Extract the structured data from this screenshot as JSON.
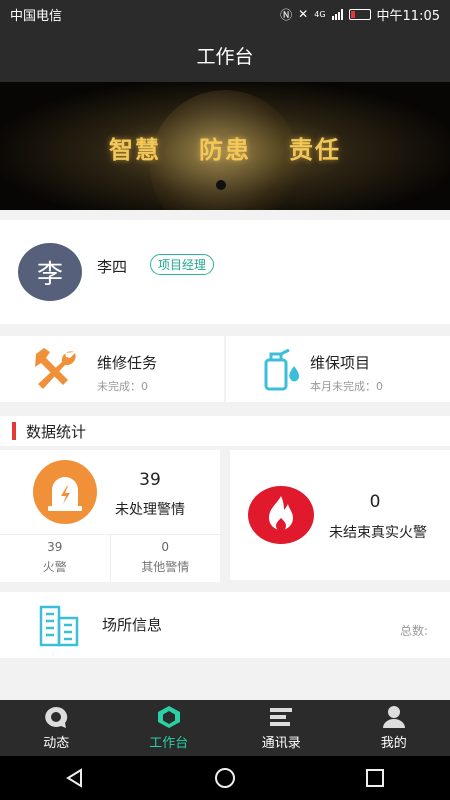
{
  "status": {
    "carrier": "中国电信",
    "time": "中午11:05",
    "network": "4G"
  },
  "header": {
    "title": "工作台"
  },
  "banner": {
    "slogans": [
      "智慧",
      "防患",
      "责任"
    ]
  },
  "user": {
    "avatar_char": "李",
    "name": "李四",
    "role": "项目经理"
  },
  "tasks": [
    {
      "title": "维修任务",
      "subtitle": "未完成：0",
      "icon": "tools-icon"
    },
    {
      "title": "维保项目",
      "subtitle": "本月未完成：0",
      "icon": "extinguisher-icon"
    }
  ],
  "stats_section": {
    "title": "数据统计"
  },
  "unhandled": {
    "count": "39",
    "label": "未处理警情"
  },
  "subcounts": [
    {
      "count": "39",
      "label": "火警"
    },
    {
      "count": "0",
      "label": "其他警情"
    }
  ],
  "fire": {
    "count": "0",
    "label": "未结束真实火警"
  },
  "place": {
    "title": "场所信息",
    "total_label": "总数:"
  },
  "tabs": [
    {
      "label": "动态",
      "icon": "chat-icon"
    },
    {
      "label": "工作台",
      "icon": "workbench-icon"
    },
    {
      "label": "通讯录",
      "icon": "contacts-icon"
    },
    {
      "label": "我的",
      "icon": "profile-icon"
    }
  ],
  "colors": {
    "accent": "#2bd0a6",
    "alarm_orange": "#f0913a",
    "fire_red": "#e0192c",
    "section_marker": "#e53935",
    "dark_bar": "#2b2b2b"
  }
}
